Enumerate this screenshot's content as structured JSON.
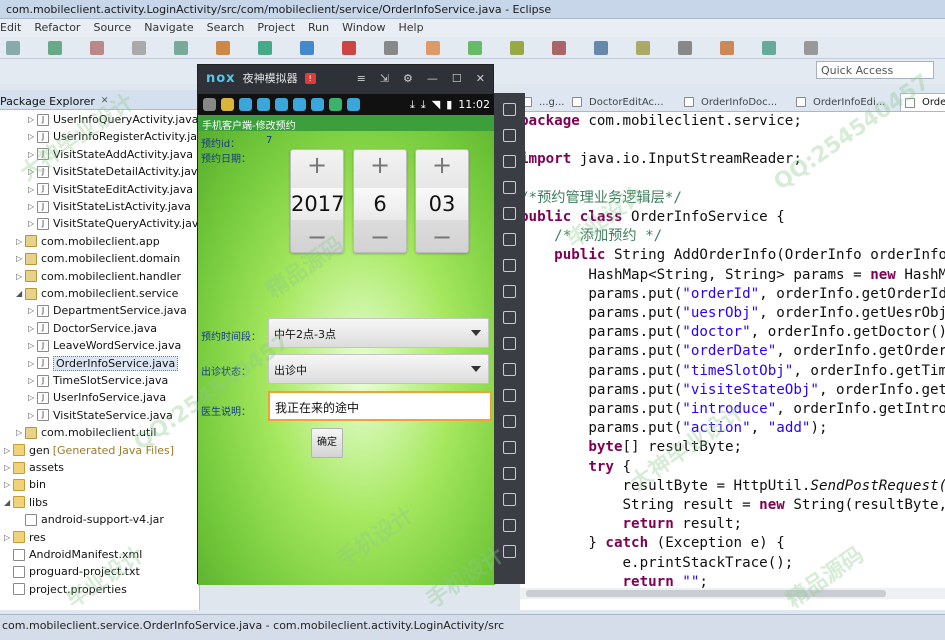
{
  "window": {
    "title": "com.mobileclient.activity.LoginActivity/src/com/mobileclient/service/OrderInfoService.java - Eclipse"
  },
  "menu": [
    "Edit",
    "Refactor",
    "Source",
    "Navigate",
    "Search",
    "Project",
    "Run",
    "Window",
    "Help"
  ],
  "quick_access": {
    "placeholder": "Quick Access"
  },
  "package_explorer": {
    "tab_label": "Package Explorer",
    "items": [
      {
        "label": "UserInfoQueryActivity.java",
        "indent": 2,
        "type": "java"
      },
      {
        "label": "UserInfoRegisterActivity.java",
        "indent": 2,
        "type": "java"
      },
      {
        "label": "VisitStateAddActivity.java",
        "indent": 2,
        "type": "java"
      },
      {
        "label": "VisitStateDetailActivity.java",
        "indent": 2,
        "type": "java"
      },
      {
        "label": "VisitStateEditActivity.java",
        "indent": 2,
        "type": "java"
      },
      {
        "label": "VisitStateListActivity.java",
        "indent": 2,
        "type": "java"
      },
      {
        "label": "VisitStateQueryActivity.java",
        "indent": 2,
        "type": "java"
      },
      {
        "label": "com.mobileclient.app",
        "indent": 1,
        "type": "package"
      },
      {
        "label": "com.mobileclient.domain",
        "indent": 1,
        "type": "package"
      },
      {
        "label": "com.mobileclient.handler",
        "indent": 1,
        "type": "package"
      },
      {
        "label": "com.mobileclient.service",
        "indent": 1,
        "type": "package",
        "expanded": true
      },
      {
        "label": "DepartmentService.java",
        "indent": 2,
        "type": "java"
      },
      {
        "label": "DoctorService.java",
        "indent": 2,
        "type": "java"
      },
      {
        "label": "LeaveWordService.java",
        "indent": 2,
        "type": "java"
      },
      {
        "label": "OrderInfoService.java",
        "indent": 2,
        "type": "java",
        "selected": true
      },
      {
        "label": "TimeSlotService.java",
        "indent": 2,
        "type": "java"
      },
      {
        "label": "UserInfoService.java",
        "indent": 2,
        "type": "java"
      },
      {
        "label": "VisitStateService.java",
        "indent": 2,
        "type": "java"
      },
      {
        "label": "com.mobileclient.util",
        "indent": 1,
        "type": "package"
      },
      {
        "label": "gen",
        "suffix": "[Generated Java Files]",
        "indent": 0,
        "type": "folder"
      },
      {
        "label": "assets",
        "indent": 0,
        "type": "folder"
      },
      {
        "label": "bin",
        "indent": 0,
        "type": "folder"
      },
      {
        "label": "libs",
        "indent": 0,
        "type": "folder",
        "expanded": true
      },
      {
        "label": "android-support-v4.jar",
        "indent": 1,
        "type": "jar"
      },
      {
        "label": "res",
        "indent": 0,
        "type": "folder"
      },
      {
        "label": "AndroidManifest.xml",
        "indent": 0,
        "type": "file"
      },
      {
        "label": "proguard-project.txt",
        "indent": 0,
        "type": "file"
      },
      {
        "label": "project.properties",
        "indent": 0,
        "type": "file"
      }
    ]
  },
  "emulator": {
    "logo": "nox",
    "title": "夜神模拟器",
    "clock": "11:02",
    "app": {
      "title": "手机客户端-修改预约",
      "order_id_label": "预约id：",
      "order_id_value": "7",
      "order_date_label": "预约日期：",
      "date_picker": [
        {
          "plus": "+",
          "value": "2017",
          "minus": "−"
        },
        {
          "plus": "+",
          "value": "6",
          "minus": "−"
        },
        {
          "plus": "+",
          "value": "03",
          "minus": "−"
        }
      ],
      "time_slot_label": "预约时间段：",
      "time_slot_value": "中午2点-3点",
      "visit_state_label": "出诊状态：",
      "visit_state_value": "出诊中",
      "doctor_note_label": "医生说明：",
      "doctor_note_value": "我正在来的途中",
      "confirm_button": "确定"
    }
  },
  "editor": {
    "tabs": [
      {
        "label": "...g..."
      },
      {
        "label": "DoctorEditAc..."
      },
      {
        "label": "OrderInfoDoc..."
      },
      {
        "label": "OrderInfoEdi..."
      },
      {
        "label": "Orde..."
      }
    ],
    "code": [
      {
        "parts": [
          {
            "t": "package",
            "c": "kw"
          },
          {
            "t": " com.mobileclient.service;"
          }
        ]
      },
      {
        "parts": [
          {
            "t": ""
          }
        ]
      },
      {
        "parts": [
          {
            "t": "import",
            "c": "kw"
          },
          {
            "t": " java.io.InputStreamReader;"
          }
        ]
      },
      {
        "parts": [
          {
            "t": ""
          }
        ]
      },
      {
        "parts": [
          {
            "t": "/*预约管理业务逻辑层*/",
            "c": "cm"
          }
        ]
      },
      {
        "parts": [
          {
            "t": "public class",
            "c": "kw"
          },
          {
            "t": " OrderInfoService {"
          }
        ]
      },
      {
        "parts": [
          {
            "t": "    /* 添加预约 */",
            "c": "cm"
          }
        ]
      },
      {
        "parts": [
          {
            "t": "    public",
            "c": "kw"
          },
          {
            "t": " String AddOrderInfo(OrderInfo orderInfo"
          }
        ]
      },
      {
        "parts": [
          {
            "t": "        HashMap<String, String> params = "
          },
          {
            "t": "new",
            "c": "kw"
          },
          {
            "t": " HashM"
          }
        ]
      },
      {
        "parts": [
          {
            "t": "        params.put("
          },
          {
            "t": "\"orderId\"",
            "c": "str"
          },
          {
            "t": ", orderInfo.getOrderId"
          }
        ]
      },
      {
        "parts": [
          {
            "t": "        params.put("
          },
          {
            "t": "\"uesrObj\"",
            "c": "str"
          },
          {
            "t": ", orderInfo.getUesrObj"
          }
        ]
      },
      {
        "parts": [
          {
            "t": "        params.put("
          },
          {
            "t": "\"doctor\"",
            "c": "str"
          },
          {
            "t": ", orderInfo.getDoctor()"
          }
        ]
      },
      {
        "parts": [
          {
            "t": "        params.put("
          },
          {
            "t": "\"orderDate\"",
            "c": "str"
          },
          {
            "t": ", orderInfo.getOrder"
          }
        ]
      },
      {
        "parts": [
          {
            "t": "        params.put("
          },
          {
            "t": "\"timeSlotObj\"",
            "c": "str"
          },
          {
            "t": ", orderInfo.getTim"
          }
        ]
      },
      {
        "parts": [
          {
            "t": "        params.put("
          },
          {
            "t": "\"visiteStateObj\"",
            "c": "str"
          },
          {
            "t": ", orderInfo.get"
          }
        ]
      },
      {
        "parts": [
          {
            "t": "        params.put("
          },
          {
            "t": "\"introduce\"",
            "c": "str"
          },
          {
            "t": ", orderInfo.getIntro"
          }
        ]
      },
      {
        "parts": [
          {
            "t": "        params.put("
          },
          {
            "t": "\"action\"",
            "c": "str"
          },
          {
            "t": ", "
          },
          {
            "t": "\"add\"",
            "c": "str"
          },
          {
            "t": ");"
          }
        ]
      },
      {
        "parts": [
          {
            "t": "        byte",
            "c": "kw"
          },
          {
            "t": "[] resultByte;"
          }
        ]
      },
      {
        "parts": [
          {
            "t": "        try",
            "c": "kw"
          },
          {
            "t": " {"
          }
        ]
      },
      {
        "parts": [
          {
            "t": "            resultByte = HttpUtil."
          },
          {
            "t": "SendPostRequest(",
            "c": "it"
          }
        ]
      },
      {
        "parts": [
          {
            "t": "            String result = "
          },
          {
            "t": "new",
            "c": "kw"
          },
          {
            "t": " String(resultByte,"
          }
        ]
      },
      {
        "parts": [
          {
            "t": "            return",
            "c": "kw"
          },
          {
            "t": " result;"
          }
        ]
      },
      {
        "parts": [
          {
            "t": "        } "
          },
          {
            "t": "catch",
            "c": "kw"
          },
          {
            "t": " (Exception e) {"
          }
        ]
      },
      {
        "parts": [
          {
            "t": "            e.printStackTrace();"
          }
        ]
      },
      {
        "parts": [
          {
            "t": "            return",
            "c": "kw"
          },
          {
            "t": " "
          },
          {
            "t": "\"\"",
            "c": "str"
          },
          {
            "t": ";"
          }
        ]
      }
    ]
  },
  "status_bar": {
    "text": "com.mobileclient.service.OrderInfoService.java - com.mobileclient.activity.LoginActivity/src"
  },
  "watermark": [
    "大神毕业设计",
    "QQ:254540457",
    "精品源码",
    "手机设计",
    "毕业设计"
  ]
}
